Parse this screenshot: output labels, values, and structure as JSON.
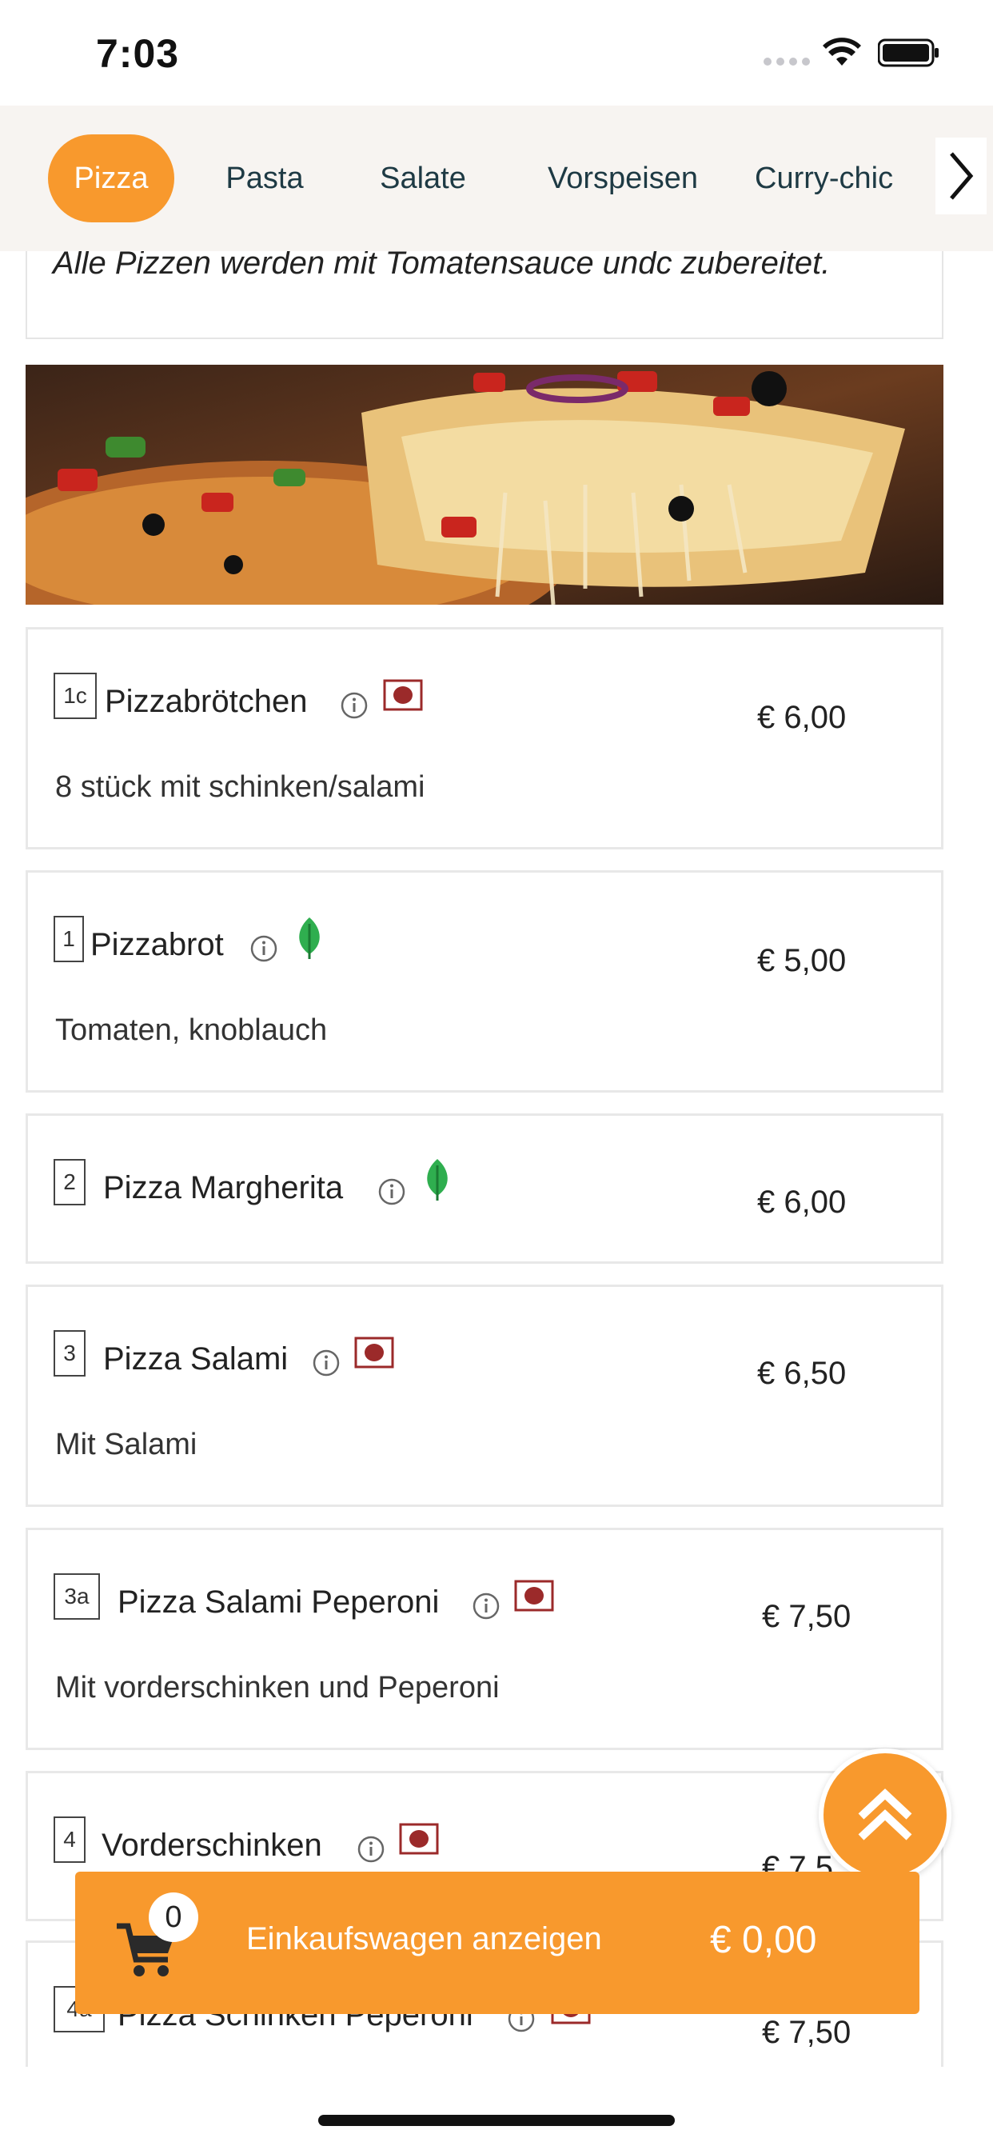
{
  "status_bar": {
    "time": "7:03"
  },
  "tabs": [
    {
      "label": "Pizza",
      "active": true
    },
    {
      "label": "Pasta",
      "active": false
    },
    {
      "label": "Salate",
      "active": false
    },
    {
      "label": "Vorspeisen",
      "active": false
    },
    {
      "label": "Curry-chic",
      "active": false
    }
  ],
  "intro": {
    "text": "Alle Pizzen werden mit Tomatensauce undc zubereitet."
  },
  "items": [
    {
      "number": "1c",
      "name": "Pizzabrötchen",
      "price": "€ 6,00",
      "description": "8 stück mit schinken/salami",
      "badge": "meat-icon"
    },
    {
      "number": "1",
      "name": "Pizzabrot",
      "price": "€ 5,00",
      "description": "Tomaten, knoblauch",
      "badge": "leaf-icon"
    },
    {
      "number": "2",
      "name": "Pizza Margherita",
      "price": "€ 6,00",
      "description": "",
      "badge": "leaf-icon"
    },
    {
      "number": "3",
      "name": "Pizza Salami",
      "price": "€ 6,50",
      "description": "Mit Salami",
      "badge": "meat-icon"
    },
    {
      "number": "3a",
      "name": "Pizza Salami Peperoni",
      "price": "€ 7,50",
      "description": "Mit vorderschinken und Peperoni",
      "badge": "meat-icon"
    },
    {
      "number": "4",
      "name": "Vorderschinken",
      "price": "€ 7,5",
      "description": "",
      "badge": "meat-icon"
    },
    {
      "number": "4a",
      "name": "Pizza Schinken Peperoni",
      "price": "€ 7,50",
      "description": "",
      "badge": "meat-icon"
    }
  ],
  "cart": {
    "count": "0",
    "label": "Einkaufswagen anzeigen",
    "total": "€ 0,00"
  },
  "colors": {
    "accent": "#f8992d",
    "tab_text": "#1e3a44",
    "meat_badge": "#9b2a2a",
    "leaf": "#2fae4f"
  }
}
